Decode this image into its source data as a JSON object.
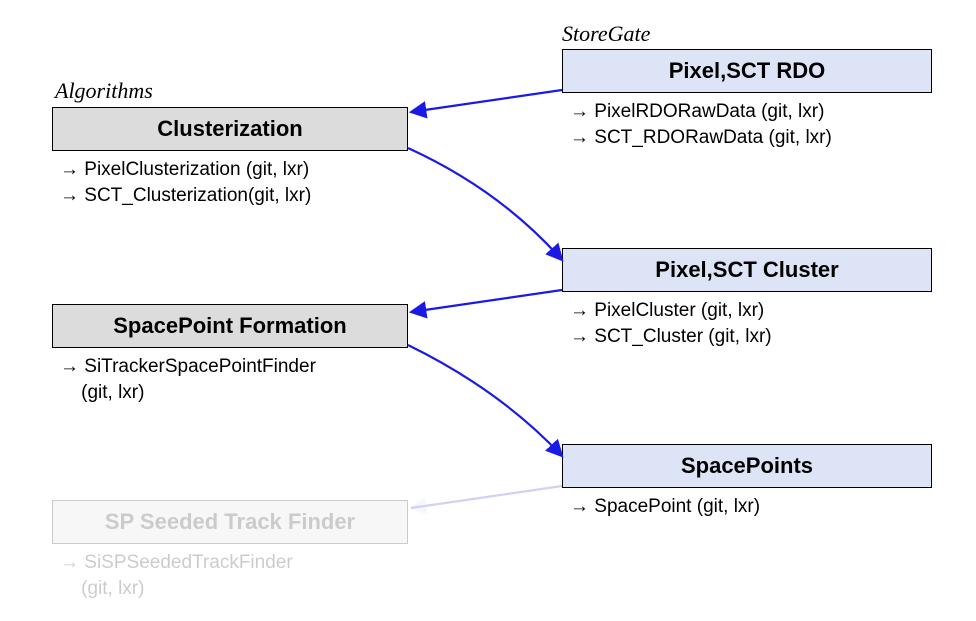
{
  "labels": {
    "algorithms": "Algorithms",
    "storegate": "StoreGate"
  },
  "nodes": {
    "rdo": {
      "title": "Pixel,SCT RDO"
    },
    "clusterization": {
      "title": "Clusterization"
    },
    "cluster": {
      "title": "Pixel,SCT Cluster"
    },
    "spformation": {
      "title": "SpacePoint Formation"
    },
    "spacepoints": {
      "title": "SpacePoints"
    },
    "sptrackfinder": {
      "title": "SP Seeded Track Finder"
    }
  },
  "details": {
    "rdo_line1": "→ PixelRDORawData (git, lxr)",
    "rdo_line2": "→ SCT_RDORawData (git, lxr)",
    "clusterization_line1": "→ PixelClusterization (git, lxr)",
    "clusterization_line2": "→ SCT_Clusterization(git, lxr)",
    "cluster_line1": "→ PixelCluster (git, lxr)",
    "cluster_line2": "→ SCT_Cluster (git, lxr)",
    "spformation_line1": "→ SiTrackerSpacePointFinder",
    "spformation_line2": "    (git, lxr)",
    "spacepoints_line1": "→ SpacePoint (git, lxr)",
    "sptrack_line1": "→ SiSPSeededTrackFinder",
    "sptrack_line2": "    (git, lxr)"
  }
}
